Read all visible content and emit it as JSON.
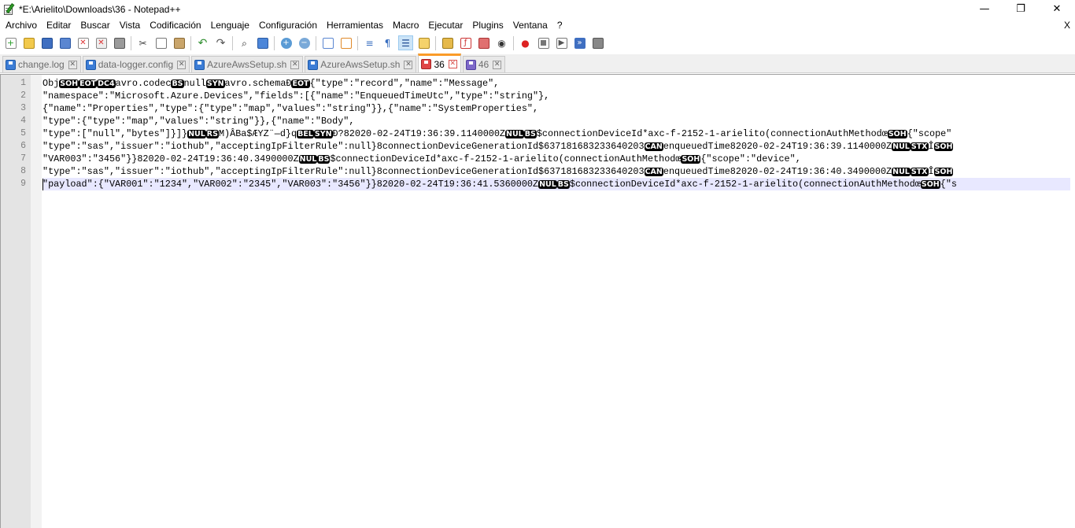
{
  "window": {
    "title": "*E:\\Arielito\\Downloads\\36 - Notepad++",
    "minimize": "—",
    "maximize": "❐",
    "close": "✕"
  },
  "menu": {
    "items": [
      "Archivo",
      "Editar",
      "Buscar",
      "Vista",
      "Codificación",
      "Lenguaje",
      "Configuración",
      "Herramientas",
      "Macro",
      "Ejecutar",
      "Plugins",
      "Ventana",
      "?"
    ],
    "close": "X"
  },
  "toolbar": {
    "icons": [
      "new-file-icon",
      "open-file-icon",
      "save-icon",
      "save-all-icon",
      "close-icon",
      "close-all-icon",
      "print-icon",
      "cut-icon",
      "copy-icon",
      "paste-icon",
      "undo-icon",
      "redo-icon",
      "find-icon",
      "replace-icon",
      "zoom-in-icon",
      "zoom-out-icon",
      "sync-vertical-icon",
      "sync-horizontal-icon",
      "word-wrap-icon",
      "show-all-chars-icon",
      "indent-guide-icon",
      "document-map-icon",
      "function-list-icon",
      "folder-workspace-icon",
      "monitoring-icon",
      "record-macro-icon",
      "stop-record-icon",
      "play-macro-icon",
      "run-macro-multiple-icon",
      "save-macro-icon"
    ]
  },
  "tabs": [
    {
      "label": "change.log",
      "icon": "blue",
      "active": false
    },
    {
      "label": "data-logger.config",
      "icon": "blue",
      "active": false
    },
    {
      "label": "AzureAwsSetup.sh",
      "icon": "blue",
      "active": false
    },
    {
      "label": "AzureAwsSetup.sh",
      "icon": "blue",
      "active": false
    },
    {
      "label": "36",
      "icon": "red",
      "active": true
    },
    {
      "label": "46",
      "icon": "purple",
      "active": false
    }
  ],
  "editor": {
    "line_numbers": [
      "1",
      "2",
      "3",
      "4",
      "5",
      "6",
      "7",
      "8",
      "9"
    ],
    "current_line": 9,
    "lines": [
      [
        {
          "t": "Obj"
        },
        {
          "c": "SOH"
        },
        {
          "c": "EOT"
        },
        {
          "c": "DC4"
        },
        {
          "t": "avro.codec"
        },
        {
          "c": "BS"
        },
        {
          "t": "null"
        },
        {
          "c": "SYN"
        },
        {
          "t": "avro.schemaÐ"
        },
        {
          "c": "EOT"
        },
        {
          "t": "{\"type\":\"record\",\"name\":\"Message\","
        }
      ],
      [
        {
          "t": "\"namespace\":\"Microsoft.Azure.Devices\",\"fields\":[{\"name\":\"EnqueuedTimeUtc\",\"type\":\"string\"},"
        }
      ],
      [
        {
          "t": "{\"name\":\"Properties\",\"type\":{\"type\":\"map\",\"values\":\"string\"}},{\"name\":\"SystemProperties\","
        }
      ],
      [
        {
          "t": "\"type\":{\"type\":\"map\",\"values\":\"string\"}},{\"name\":\"Body\","
        }
      ],
      [
        {
          "t": "\"type\":[\"null\",\"bytes\"]}]}"
        },
        {
          "c": "NUL"
        },
        {
          "c": "RS"
        },
        {
          "t": "M)ÂBa$ÆYZ¨—d}q"
        },
        {
          "c": "BEL"
        },
        {
          "c": "SYN"
        },
        {
          "t": "Ð?82020-02-24T19:36:39.1140000Z"
        },
        {
          "c": "NUL"
        },
        {
          "c": "BS"
        },
        {
          "t": "$connectionDeviceId*axc-f-2152-1-arielito(connectionAuthMethodœ"
        },
        {
          "c": "SOH"
        },
        {
          "t": "{\"scope\""
        }
      ],
      [
        {
          "t": "\"type\":\"sas\",\"issuer\":\"iothub\",\"acceptingIpFilterRule\":null}8connectionDeviceGenerationId$637181683233640203"
        },
        {
          "c": "CAN"
        },
        {
          "t": "enqueuedTime82020-02-24T19:36:39.1140000Z"
        },
        {
          "c": "NUL"
        },
        {
          "c": "STX"
        },
        {
          "t": "Î"
        },
        {
          "c": "SOH"
        }
      ],
      [
        {
          "t": "\"VAR003\":\"3456\"}}82020-02-24T19:36:40.3490000Z"
        },
        {
          "c": "NUL"
        },
        {
          "c": "BS"
        },
        {
          "t": "$connectionDeviceId*axc-f-2152-1-arielito(connectionAuthMethodœ"
        },
        {
          "c": "SOH"
        },
        {
          "t": "{\"scope\":\"device\","
        }
      ],
      [
        {
          "t": "\"type\":\"sas\",\"issuer\":\"iothub\",\"acceptingIpFilterRule\":null}8connectionDeviceGenerationId$637181683233640203"
        },
        {
          "c": "CAN"
        },
        {
          "t": "enqueuedTime82020-02-24T19:36:40.3490000Z"
        },
        {
          "c": "NUL"
        },
        {
          "c": "STX"
        },
        {
          "t": "Î"
        },
        {
          "c": "SOH"
        }
      ],
      [
        {
          "t": "\"payload\":{\"VAR001\":\"1234\",\"VAR002\":\"2345\",\"VAR003\":\"3456\"}}82020-02-24T19:36:41.5360000Z"
        },
        {
          "c": "NUL"
        },
        {
          "c": "BS"
        },
        {
          "t": "$connectionDeviceId*axc-f-2152-1-arielito(connectionAuthMethodœ"
        },
        {
          "c": "SOH"
        },
        {
          "t": "{\"s"
        }
      ]
    ]
  },
  "colors": {
    "active_tab_accent": "#fa9b28",
    "gutter": "#e4e4e4",
    "current_line": "#e8e8ff",
    "control_char_bg": "#000000"
  }
}
